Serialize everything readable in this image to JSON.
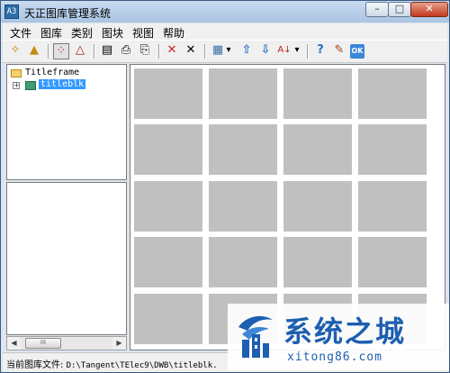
{
  "window": {
    "title": "天正图库管理系统",
    "minimize": "–",
    "maximize": "□",
    "close": "✕",
    "icon_text": "A3"
  },
  "menu": [
    "文件",
    "图库",
    "类别",
    "图块",
    "视图",
    "帮助"
  ],
  "toolbar": {
    "buttons": [
      {
        "name": "new-icon",
        "glyph": "✧"
      },
      {
        "name": "open-icon",
        "glyph": "▲"
      },
      {
        "name": "dotted-select-icon",
        "glyph": "⁘"
      },
      {
        "name": "triangle-icon",
        "glyph": "△"
      },
      {
        "name": "layout1-icon",
        "glyph": "▤"
      },
      {
        "name": "layout2-icon",
        "glyph": "⎙"
      },
      {
        "name": "layout3-icon",
        "glyph": "⎘"
      },
      {
        "name": "delete-red-icon",
        "glyph": "✕"
      },
      {
        "name": "delete-icon",
        "glyph": "✕"
      },
      {
        "name": "view-mode-icon",
        "glyph": "▦"
      },
      {
        "name": "dropdown1-icon",
        "glyph": "▾"
      },
      {
        "name": "move-up-icon",
        "glyph": "⇧"
      },
      {
        "name": "move-down-icon",
        "glyph": "⇩"
      },
      {
        "name": "sort-icon",
        "glyph": "A↓"
      },
      {
        "name": "dropdown2-icon",
        "glyph": "▾"
      },
      {
        "name": "help-icon",
        "glyph": "?"
      },
      {
        "name": "edit-icon",
        "glyph": "✎"
      },
      {
        "name": "ok-icon",
        "glyph": "OK"
      }
    ],
    "colors": {
      "delete_red": "#d42020",
      "arrows": "#2a6fc2",
      "ok_bg": "#3a86d8"
    }
  },
  "tree": {
    "root": {
      "label": "Titleframe"
    },
    "child": {
      "label": "titleblk",
      "expander": "+"
    }
  },
  "scroll": {
    "left": "◀",
    "right": "▶",
    "thumb": "III"
  },
  "grid": {
    "cell_color": "#c0c0c0",
    "columns": 4,
    "rows": 5
  },
  "status": {
    "label": "当前图库文件:",
    "path": "D:\\Tangent\\TElec9\\DWB\\titleblk."
  },
  "watermark": {
    "title": "系统之城",
    "url": "xitong86.com",
    "color": "#1d5fb0"
  }
}
